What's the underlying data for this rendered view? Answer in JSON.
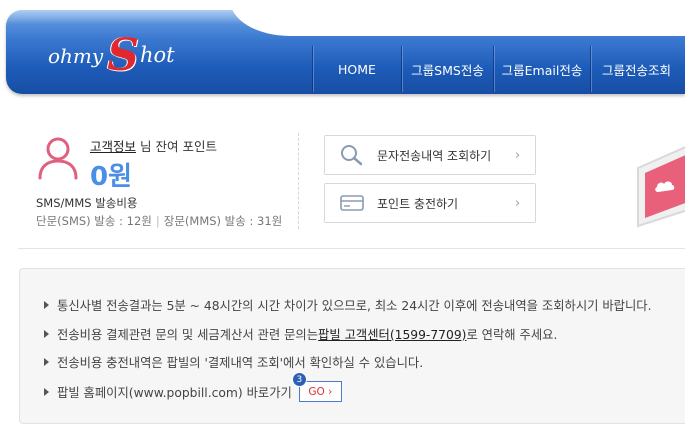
{
  "header": {
    "logo": {
      "part1": "ohmy",
      "part2": "S",
      "part3": "hot"
    },
    "nav": [
      {
        "label": "HOME"
      },
      {
        "label": "그룹SMS전송"
      },
      {
        "label": "그룹Email전송"
      },
      {
        "label": "그룹전송조회"
      }
    ]
  },
  "points": {
    "user_link": "고객정보",
    "suffix": "님 잔여 포인트",
    "amount": "0원",
    "cost_title": "SMS/MMS 발송비용",
    "sms_cost": "단문(SMS) 발송 : 12원",
    "separator": "|",
    "mms_cost": "장문(MMS) 발송 : 31원"
  },
  "actions": [
    {
      "label": "문자전송내역 조회하기",
      "icon": "search-icon"
    },
    {
      "label": "포인트 충전하기",
      "icon": "card-icon"
    }
  ],
  "notice": {
    "item1": "통신사별 전송결과는 5분 ~ 48시간의 시간 차이가 있으므로, 최소 24시간 이후에 전송내역을 조회하시기 바랍니다.",
    "item2_before": "전송비용 결제관련 문의 및 세금계산서 관련 문의는 ",
    "item2_link": "팝빌 고객센터(1599-7709)",
    "item2_after": "로 연락해 주세요.",
    "item3": "전송비용 충전내역은 팝빌의 '결제내역 조회'에서 확인하실 수 있습니다.",
    "item4": "팝빌 홈페이지(www.popbill.com) 바로가기",
    "go_label": "GO ›",
    "go_badge": "3"
  },
  "colors": {
    "header_blue": "#1d5bb8",
    "amount_blue": "#4a8ee6",
    "user_icon_pink": "#e0607e",
    "go_red": "#e03030"
  }
}
